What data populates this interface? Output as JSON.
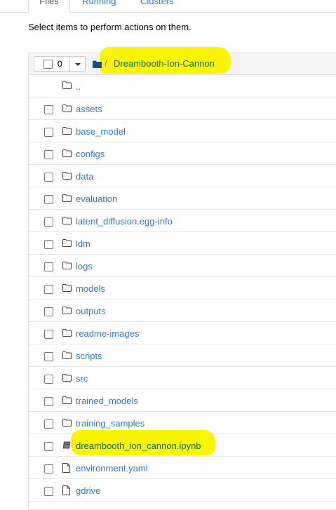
{
  "tabs": [
    {
      "label": "Files",
      "active": true
    },
    {
      "label": "Running",
      "active": false
    },
    {
      "label": "Clusters",
      "active": false
    }
  ],
  "notice": "Select items to perform actions on them.",
  "toolbar": {
    "selected_count": "0",
    "breadcrumb_sep": "/",
    "current_folder": "Dreambooth-Ion-Cannon"
  },
  "items": [
    {
      "name": "..",
      "type": "parent",
      "icon": "folder-icon"
    },
    {
      "name": "assets",
      "type": "folder",
      "icon": "folder-icon"
    },
    {
      "name": "base_model",
      "type": "folder",
      "icon": "folder-icon"
    },
    {
      "name": "configs",
      "type": "folder",
      "icon": "folder-icon"
    },
    {
      "name": "data",
      "type": "folder",
      "icon": "folder-icon"
    },
    {
      "name": "evaluation",
      "type": "folder",
      "icon": "folder-icon"
    },
    {
      "name": "latent_diffusion.egg-info",
      "type": "folder",
      "icon": "folder-icon"
    },
    {
      "name": "ldm",
      "type": "folder",
      "icon": "folder-icon"
    },
    {
      "name": "logs",
      "type": "folder",
      "icon": "folder-icon"
    },
    {
      "name": "models",
      "type": "folder",
      "icon": "folder-icon"
    },
    {
      "name": "outputs",
      "type": "folder",
      "icon": "folder-icon"
    },
    {
      "name": "readme-images",
      "type": "folder",
      "icon": "folder-icon"
    },
    {
      "name": "scripts",
      "type": "folder",
      "icon": "folder-icon"
    },
    {
      "name": "src",
      "type": "folder",
      "icon": "folder-icon"
    },
    {
      "name": "trained_models",
      "type": "folder",
      "icon": "folder-icon"
    },
    {
      "name": "training_samples",
      "type": "folder",
      "icon": "folder-icon"
    },
    {
      "name": "dreambooth_ion_cannon.ipynb",
      "type": "notebook",
      "icon": "notebook-icon"
    },
    {
      "name": "environment.yaml",
      "type": "file",
      "icon": "file-icon"
    },
    {
      "name": "gdrive",
      "type": "file",
      "icon": "file-icon"
    }
  ],
  "colors": {
    "link": "#337ab7",
    "highlight": "#f9f400"
  }
}
